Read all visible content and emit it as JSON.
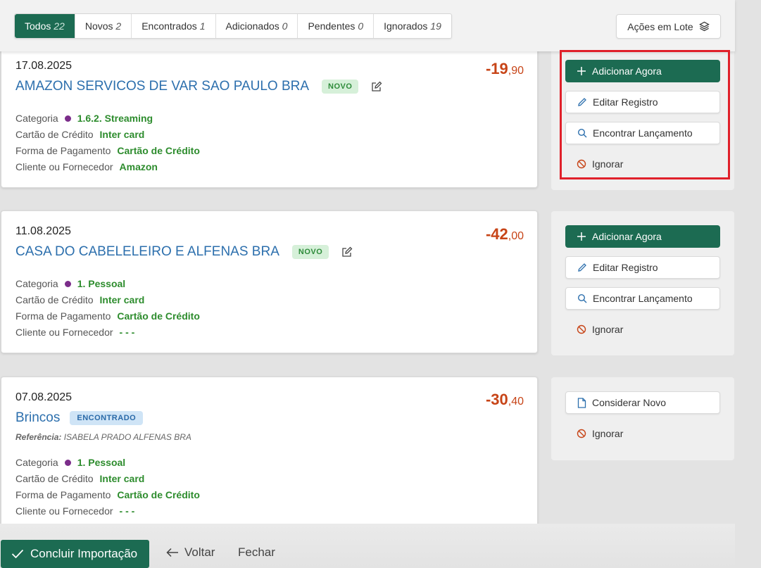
{
  "filters": [
    {
      "label": "Todos",
      "count": "22",
      "active": true
    },
    {
      "label": "Novos",
      "count": "2"
    },
    {
      "label": "Encontrados",
      "count": "1"
    },
    {
      "label": "Adicionados",
      "count": "0"
    },
    {
      "label": "Pendentes",
      "count": "0"
    },
    {
      "label": "Ignorados",
      "count": "19"
    }
  ],
  "batch_actions_label": "Ações em Lote",
  "field_labels": {
    "category": "Categoria",
    "card": "Cartão de Crédito",
    "payment": "Forma de Pagamento",
    "client": "Cliente ou Fornecedor"
  },
  "transactions": [
    {
      "date": "17.08.2025",
      "title": "AMAZON SERVICOS DE VAR SAO PAULO BRA",
      "badge": "NOVO",
      "amount_int": "-19",
      "amount_dec": ",90",
      "category": "1.6.2. Streaming",
      "card": "Inter card",
      "payment": "Cartão de Crédito",
      "client": "Amazon",
      "actions": [
        "Adicionar Agora",
        "Editar Registro",
        "Encontrar Lançamento",
        "Ignorar"
      ]
    },
    {
      "date": "11.08.2025",
      "title": "CASA DO CABELELEIRO E ALFENAS BRA",
      "badge": "NOVO",
      "amount_int": "-42",
      "amount_dec": ",00",
      "category": "1. Pessoal",
      "card": "Inter card",
      "payment": "Cartão de Crédito",
      "client": "- - -",
      "actions": [
        "Adicionar Agora",
        "Editar Registro",
        "Encontrar Lançamento",
        "Ignorar"
      ]
    },
    {
      "date": "07.08.2025",
      "title": "Brincos",
      "badge": "ENCONTRADO",
      "reference_label": "Referência:",
      "reference_value": "ISABELA PRADO ALFENAS BRA",
      "amount_int": "-30",
      "amount_dec": ",40",
      "category": "1. Pessoal",
      "card": "Inter card",
      "payment": "Cartão de Crédito",
      "client": "- - -",
      "actions": [
        "Considerar Novo",
        "Ignorar"
      ]
    }
  ],
  "footer": {
    "conclude_label": "Concluir Importação",
    "back_label": "Voltar",
    "close_label": "Fechar"
  },
  "colors": {
    "primary": "#1c6b52",
    "link": "#2c6fad",
    "amount": "#c74417",
    "value_green": "#2d8c2d",
    "category_dot": "#7b2d8a",
    "highlight": "#e0202a"
  }
}
